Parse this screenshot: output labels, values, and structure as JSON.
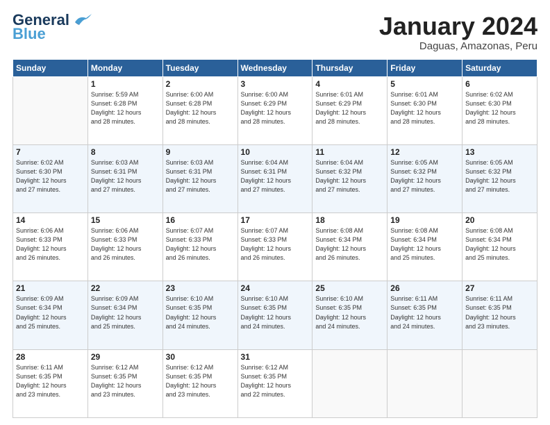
{
  "logo": {
    "line1": "General",
    "line2": "Blue"
  },
  "title": "January 2024",
  "subtitle": "Daguas, Amazonas, Peru",
  "columns": [
    "Sunday",
    "Monday",
    "Tuesday",
    "Wednesday",
    "Thursday",
    "Friday",
    "Saturday"
  ],
  "weeks": [
    [
      {
        "day": "",
        "info": ""
      },
      {
        "day": "1",
        "info": "Sunrise: 5:59 AM\nSunset: 6:28 PM\nDaylight: 12 hours\nand 28 minutes."
      },
      {
        "day": "2",
        "info": "Sunrise: 6:00 AM\nSunset: 6:28 PM\nDaylight: 12 hours\nand 28 minutes."
      },
      {
        "day": "3",
        "info": "Sunrise: 6:00 AM\nSunset: 6:29 PM\nDaylight: 12 hours\nand 28 minutes."
      },
      {
        "day": "4",
        "info": "Sunrise: 6:01 AM\nSunset: 6:29 PM\nDaylight: 12 hours\nand 28 minutes."
      },
      {
        "day": "5",
        "info": "Sunrise: 6:01 AM\nSunset: 6:30 PM\nDaylight: 12 hours\nand 28 minutes."
      },
      {
        "day": "6",
        "info": "Sunrise: 6:02 AM\nSunset: 6:30 PM\nDaylight: 12 hours\nand 28 minutes."
      }
    ],
    [
      {
        "day": "7",
        "info": "Sunrise: 6:02 AM\nSunset: 6:30 PM\nDaylight: 12 hours\nand 27 minutes."
      },
      {
        "day": "8",
        "info": "Sunrise: 6:03 AM\nSunset: 6:31 PM\nDaylight: 12 hours\nand 27 minutes."
      },
      {
        "day": "9",
        "info": "Sunrise: 6:03 AM\nSunset: 6:31 PM\nDaylight: 12 hours\nand 27 minutes."
      },
      {
        "day": "10",
        "info": "Sunrise: 6:04 AM\nSunset: 6:31 PM\nDaylight: 12 hours\nand 27 minutes."
      },
      {
        "day": "11",
        "info": "Sunrise: 6:04 AM\nSunset: 6:32 PM\nDaylight: 12 hours\nand 27 minutes."
      },
      {
        "day": "12",
        "info": "Sunrise: 6:05 AM\nSunset: 6:32 PM\nDaylight: 12 hours\nand 27 minutes."
      },
      {
        "day": "13",
        "info": "Sunrise: 6:05 AM\nSunset: 6:32 PM\nDaylight: 12 hours\nand 27 minutes."
      }
    ],
    [
      {
        "day": "14",
        "info": "Sunrise: 6:06 AM\nSunset: 6:33 PM\nDaylight: 12 hours\nand 26 minutes."
      },
      {
        "day": "15",
        "info": "Sunrise: 6:06 AM\nSunset: 6:33 PM\nDaylight: 12 hours\nand 26 minutes."
      },
      {
        "day": "16",
        "info": "Sunrise: 6:07 AM\nSunset: 6:33 PM\nDaylight: 12 hours\nand 26 minutes."
      },
      {
        "day": "17",
        "info": "Sunrise: 6:07 AM\nSunset: 6:33 PM\nDaylight: 12 hours\nand 26 minutes."
      },
      {
        "day": "18",
        "info": "Sunrise: 6:08 AM\nSunset: 6:34 PM\nDaylight: 12 hours\nand 26 minutes."
      },
      {
        "day": "19",
        "info": "Sunrise: 6:08 AM\nSunset: 6:34 PM\nDaylight: 12 hours\nand 25 minutes."
      },
      {
        "day": "20",
        "info": "Sunrise: 6:08 AM\nSunset: 6:34 PM\nDaylight: 12 hours\nand 25 minutes."
      }
    ],
    [
      {
        "day": "21",
        "info": "Sunrise: 6:09 AM\nSunset: 6:34 PM\nDaylight: 12 hours\nand 25 minutes."
      },
      {
        "day": "22",
        "info": "Sunrise: 6:09 AM\nSunset: 6:34 PM\nDaylight: 12 hours\nand 25 minutes."
      },
      {
        "day": "23",
        "info": "Sunrise: 6:10 AM\nSunset: 6:35 PM\nDaylight: 12 hours\nand 24 minutes."
      },
      {
        "day": "24",
        "info": "Sunrise: 6:10 AM\nSunset: 6:35 PM\nDaylight: 12 hours\nand 24 minutes."
      },
      {
        "day": "25",
        "info": "Sunrise: 6:10 AM\nSunset: 6:35 PM\nDaylight: 12 hours\nand 24 minutes."
      },
      {
        "day": "26",
        "info": "Sunrise: 6:11 AM\nSunset: 6:35 PM\nDaylight: 12 hours\nand 24 minutes."
      },
      {
        "day": "27",
        "info": "Sunrise: 6:11 AM\nSunset: 6:35 PM\nDaylight: 12 hours\nand 23 minutes."
      }
    ],
    [
      {
        "day": "28",
        "info": "Sunrise: 6:11 AM\nSunset: 6:35 PM\nDaylight: 12 hours\nand 23 minutes."
      },
      {
        "day": "29",
        "info": "Sunrise: 6:12 AM\nSunset: 6:35 PM\nDaylight: 12 hours\nand 23 minutes."
      },
      {
        "day": "30",
        "info": "Sunrise: 6:12 AM\nSunset: 6:35 PM\nDaylight: 12 hours\nand 23 minutes."
      },
      {
        "day": "31",
        "info": "Sunrise: 6:12 AM\nSunset: 6:35 PM\nDaylight: 12 hours\nand 22 minutes."
      },
      {
        "day": "",
        "info": ""
      },
      {
        "day": "",
        "info": ""
      },
      {
        "day": "",
        "info": ""
      }
    ]
  ]
}
